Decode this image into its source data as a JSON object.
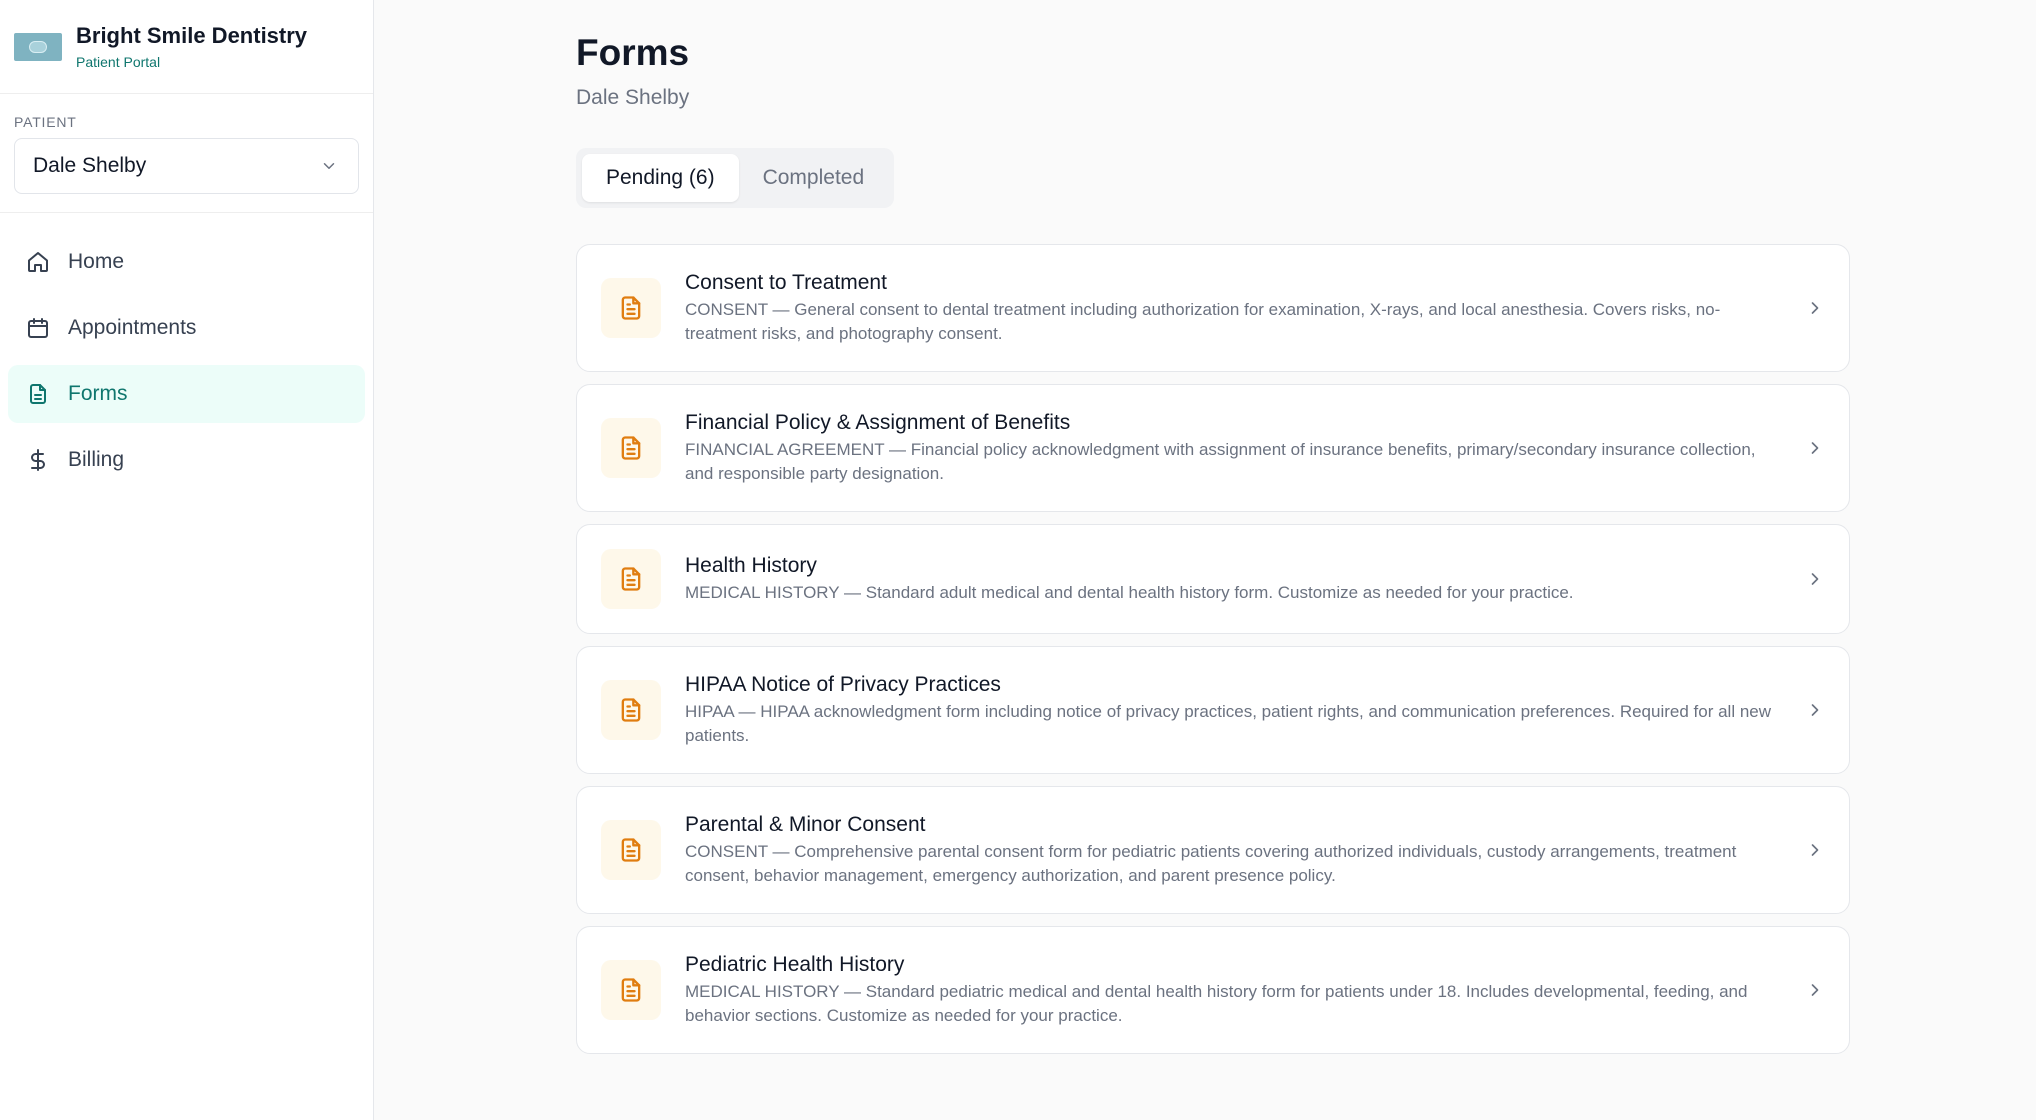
{
  "brand": {
    "name": "Bright Smile Dentistry",
    "subtitle": "Patient Portal"
  },
  "patient": {
    "label": "PATIENT",
    "selected": "Dale Shelby"
  },
  "nav": {
    "items": [
      {
        "label": "Home",
        "icon": "home-icon"
      },
      {
        "label": "Appointments",
        "icon": "calendar-icon"
      },
      {
        "label": "Forms",
        "icon": "document-icon",
        "active": true
      },
      {
        "label": "Billing",
        "icon": "dollar-icon"
      }
    ]
  },
  "page": {
    "title": "Forms",
    "subtitle": "Dale Shelby"
  },
  "tabs": [
    {
      "label": "Pending (6)",
      "active": true
    },
    {
      "label": "Completed",
      "active": false
    }
  ],
  "forms": [
    {
      "title": "Consent to Treatment",
      "description": "CONSENT — General consent to dental treatment including authorization for examination, X-rays, and local anesthesia. Covers risks, no-treatment risks, and photography consent."
    },
    {
      "title": "Financial Policy & Assignment of Benefits",
      "description": "FINANCIAL AGREEMENT — Financial policy acknowledgment with assignment of insurance benefits, primary/secondary insurance collection, and responsible party designation."
    },
    {
      "title": "Health History",
      "description": "MEDICAL HISTORY — Standard adult medical and dental health history form. Customize as needed for your practice."
    },
    {
      "title": "HIPAA Notice of Privacy Practices",
      "description": "HIPAA — HIPAA acknowledgment form including notice of privacy practices, patient rights, and communication preferences. Required for all new patients."
    },
    {
      "title": "Parental & Minor Consent",
      "description": "CONSENT — Comprehensive parental consent form for pediatric patients covering authorized individuals, custody arrangements, treatment consent, behavior management, emergency authorization, and parent presence policy."
    },
    {
      "title": "Pediatric Health History",
      "description": "MEDICAL HISTORY — Standard pediatric medical and dental health history form for patients under 18. Includes developmental, feeding, and behavior sections. Customize as needed for your practice."
    }
  ],
  "colors": {
    "accent": "#0f766e",
    "active_nav_bg": "#ecfdf9",
    "form_icon": "#e07d10",
    "form_icon_bg": "#fef8ea"
  }
}
